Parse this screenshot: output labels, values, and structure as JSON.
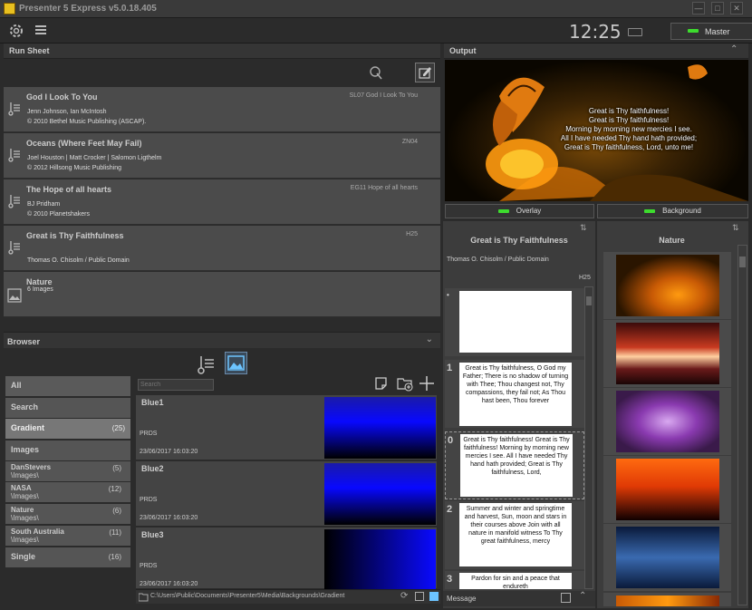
{
  "app": {
    "title": "Presenter 5 Express  v5.0.18.405"
  },
  "window": {
    "min_label": "—",
    "max_label": "□",
    "close_label": "✕"
  },
  "toolbar": {
    "clock": "12:25",
    "master_label": "Master"
  },
  "run_sheet": {
    "header": "Run Sheet",
    "items": [
      {
        "title": "God I Look To You",
        "code": "SL07 God I Look To You",
        "line1": "Jenn Johnson, Ian McIntosh",
        "line2": "© 2010 Bethel Music Publishing (ASCAP)."
      },
      {
        "title": "Oceans (Where Feet May Fail)",
        "code": "ZN04",
        "line1": "Joel Houston | Matt Crocker | Salomon Ligthelm",
        "line2": "© 2012 Hillsong Music Publishing"
      },
      {
        "title": "The Hope of all hearts",
        "code": "EG11 Hope of all hearts",
        "line1": "BJ Pridham",
        "line2": "© 2010 Planetshakers"
      },
      {
        "title": "Great is Thy Faithfulness",
        "code": "H25",
        "line1": "",
        "line2": "Thomas O. Chisolm / Public Domain"
      },
      {
        "title": "Nature",
        "code": "",
        "line1": "6 Images",
        "line2": ""
      }
    ]
  },
  "browser": {
    "header": "Browser",
    "search_placeholder": "Search",
    "categories": [
      {
        "label": "All",
        "count": ""
      },
      {
        "label": "Search",
        "count": ""
      },
      {
        "label": "Gradient",
        "count": "(25)"
      },
      {
        "label": "Images",
        "count": ""
      }
    ],
    "subfolders": [
      {
        "name": "DanStevers",
        "path": "\\Images\\",
        "count": "(5)"
      },
      {
        "name": "NASA",
        "path": "\\Images\\",
        "count": "(12)"
      },
      {
        "name": "Nature",
        "path": "\\Images\\",
        "count": "(6)"
      },
      {
        "name": "South Australia",
        "path": "\\Images\\",
        "count": "(11)"
      }
    ],
    "single": {
      "label": "Single",
      "count": "(16)"
    },
    "items": [
      {
        "title": "Blue1",
        "sub": "PRDS",
        "date": "23/06/2017 16:03:20"
      },
      {
        "title": "Blue2",
        "sub": "PRDS",
        "date": "23/06/2017 16:03:20"
      },
      {
        "title": "Blue3",
        "sub": "PRDS",
        "date": "23/06/2017 16:03:20"
      }
    ],
    "path": "C:\\Users\\Public\\Documents\\Presenter5\\Media\\Backgrounds\\Gradient"
  },
  "output": {
    "header": "Output",
    "lyrics": [
      "Great is Thy faithfulness!",
      "Great is Thy faithfulness!",
      "Morning by morning new mercies I see.",
      "All I have needed Thy hand hath provided;",
      "Great is Thy faithfulness, Lord, unto me!"
    ],
    "overlay_label": "Overlay",
    "background_label": "Background"
  },
  "song_panel": {
    "title": "Great is Thy Faithfulness",
    "author": "Thomas O. Chisolm / Public Domain",
    "code": "H25",
    "slides": [
      {
        "num": "•",
        "text": ""
      },
      {
        "num": "1",
        "text": "Great is Thy faithfulness, O God my Father; There is no shadow of turning with Thee; Thou changest not, Thy compassions, they fail not; As Thou hast been, Thou forever"
      },
      {
        "num": "0",
        "text": "Great is Thy faithfulness! Great is Thy faithfulness! Morning by morning new mercies I see. All I have needed Thy hand hath provided; Great is Thy faithfulness, Lord,"
      },
      {
        "num": "2",
        "text": "Summer and winter and springtime and harvest, Sun, moon and stars in their courses above Join with all nature in manifold witness To Thy great faithfulness, mercy"
      },
      {
        "num": "3",
        "text": "Pardon for sin and a peace that endureth"
      }
    ],
    "message_label": "Message"
  },
  "nature_panel": {
    "title": "Nature"
  },
  "colors": {
    "accent_green": "#3ddc2e",
    "panel_bg": "#2b2b2b",
    "item_bg": "#4b4b4b"
  }
}
